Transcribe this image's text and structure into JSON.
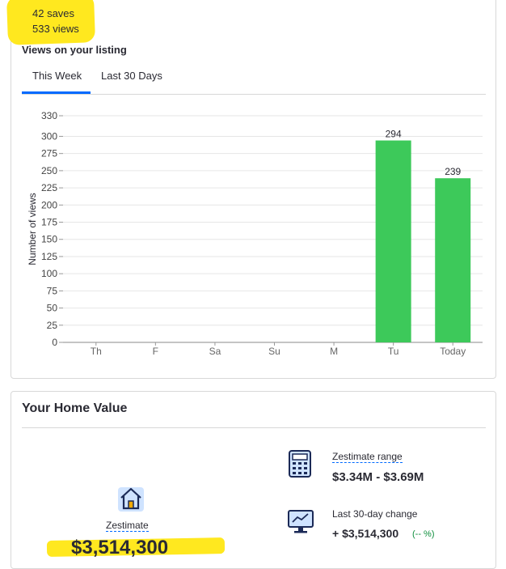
{
  "stats": {
    "saves": "42 saves",
    "views": "533 views"
  },
  "views_section": {
    "title": "Views on your listing",
    "tabs": [
      {
        "label": "This Week"
      },
      {
        "label": "Last 30 Days"
      }
    ],
    "active_tab": "This Week"
  },
  "chart_data": {
    "type": "bar",
    "categories": [
      "Th",
      "F",
      "Sa",
      "Su",
      "M",
      "Tu",
      "Today"
    ],
    "values": [
      0,
      0,
      0,
      0,
      0,
      294,
      239
    ],
    "data_labels": [
      "",
      "",
      "",
      "",
      "",
      "294",
      "239"
    ],
    "ylabel": "Number of views",
    "xlabel": "",
    "ylim": [
      0,
      330
    ],
    "yticks": [
      0,
      25,
      50,
      75,
      100,
      125,
      150,
      175,
      200,
      225,
      250,
      275,
      300,
      330
    ],
    "grid": true,
    "bar_color": "#3dc95a"
  },
  "home_value": {
    "title": "Your Home Value",
    "zestimate_label": "Zestimate",
    "zestimate_value": "$3,514,300",
    "range_label": "Zestimate range",
    "range_value": "$3.34M - $3.69M",
    "change_label": "Last 30-day change",
    "change_value": "+ $3,514,300",
    "change_pct": "(-- %)"
  },
  "colors": {
    "accent": "#006aff",
    "highlight": "#ffe81f",
    "bar": "#3dc95a",
    "positive": "#0d8e3c"
  },
  "icons": {
    "house": "house-icon",
    "calculator": "calculator-icon",
    "monitor": "monitor-chart-icon"
  }
}
